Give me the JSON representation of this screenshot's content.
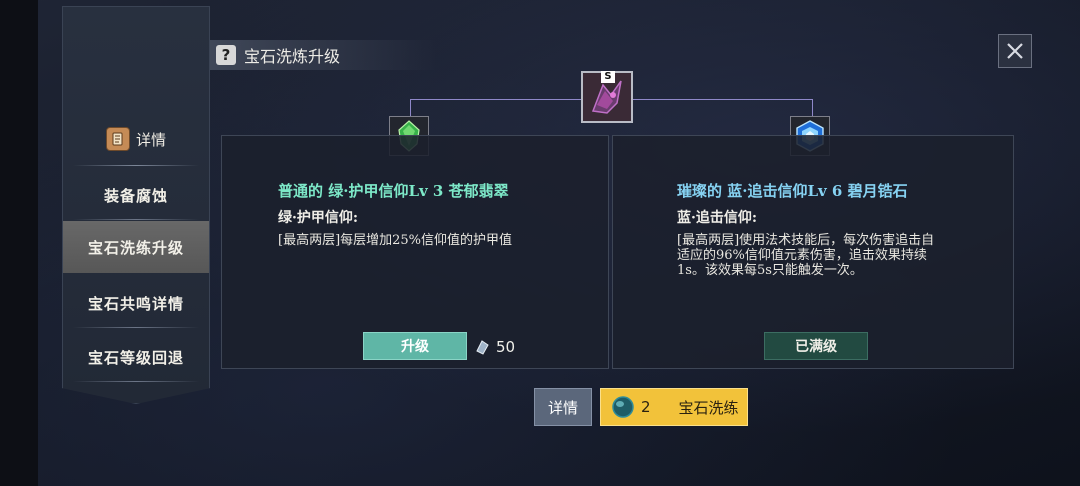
{
  "title": "宝石洗炼升级",
  "sidebar": {
    "header": "详情",
    "items": [
      {
        "label": "装备腐蚀",
        "active": false
      },
      {
        "label": "宝石洗练升级",
        "active": true
      },
      {
        "label": "宝石共鸣详情",
        "active": false
      },
      {
        "label": "宝石等级回退",
        "active": false
      }
    ]
  },
  "top_gem": {
    "badge": "S"
  },
  "left_panel": {
    "title": "普通的 绿·护甲信仰Lv 3 苍郁翡翠",
    "subtitle": "绿·护甲信仰:",
    "description": "[最高两层]每层增加25%信仰值的护甲值",
    "button_label": "升级",
    "cost": "50",
    "title_color": "#7de8c8"
  },
  "right_panel": {
    "title": "璀璨的 蓝·追击信仰Lv 6 碧月锆石",
    "subtitle": "蓝·追击信仰:",
    "description": "[最高两层]使用法术技能后，每次伤害追击自适应的96%信仰值元素伤害，追击效果持续1s。该效果每5s只能触发一次。",
    "button_label": "已满级",
    "title_color": "#86d2f2"
  },
  "footer": {
    "detail_label": "详情",
    "refine_count": "2",
    "refine_label": "宝石洗练"
  },
  "icons": {
    "close": "close-icon",
    "help": "question-icon",
    "scroll": "scroll-icon",
    "green_gem": "green-gem-icon",
    "blue_gem": "blue-gem-icon",
    "crystal": "crystal-icon",
    "teal_gem": "teal-gem-icon"
  }
}
